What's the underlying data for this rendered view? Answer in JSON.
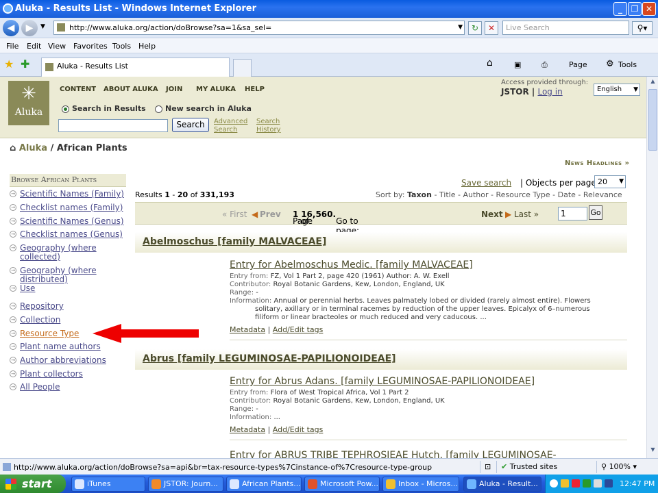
{
  "browser": {
    "title": "Aluka - Results List - Windows Internet Explorer",
    "address": "http://www.aluka.org/action/doBrowse?sa=1&sa_sel=",
    "search_placeholder": "Live Search",
    "menu": [
      "File",
      "Edit",
      "View",
      "Favorites",
      "Tools",
      "Help"
    ],
    "tab_title": "Aluka - Results List",
    "toolbar": {
      "page": "Page",
      "tools": "Tools"
    }
  },
  "site": {
    "logo_text": "Aluka",
    "nav": [
      "CONTENT",
      "ABOUT ALUKA",
      "JOIN",
      "MY ALUKA",
      "HELP"
    ],
    "access_label": "Access provided through:",
    "access_org": "JSTOR",
    "login": "Log in",
    "language": "English",
    "search_in_results": "Search in Results",
    "new_search": "New search in Aluka",
    "search_button": "Search",
    "advanced_search_1": "Advanced",
    "advanced_search_2": "Search",
    "search_history_1": "Search",
    "search_history_2": "History"
  },
  "breadcrumb": {
    "home": "Aluka",
    "sep": "/",
    "current": "African Plants"
  },
  "news_headlines": "News Headlines",
  "sidebar": {
    "heading": "Browse African Plants",
    "items": [
      {
        "label": "Scientific Names (Family)"
      },
      {
        "label": "Checklist names (Family)"
      },
      {
        "label": "Scientific Names (Genus)"
      },
      {
        "label": "Checklist names (Genus)"
      },
      {
        "label": "Geography (where",
        "label2": "collected)"
      },
      {
        "label": "Geography (where",
        "label2": "distributed)"
      },
      {
        "label": "Use"
      },
      {
        "label": "Repository"
      },
      {
        "label": "Collection"
      },
      {
        "label": "Resource Type"
      },
      {
        "label": "Plant name authors"
      },
      {
        "label": "Author abbreviations"
      },
      {
        "label": "Plant collectors"
      },
      {
        "label": "All People"
      }
    ]
  },
  "results": {
    "results_prefix": "Results",
    "range_start": "1",
    "range_sep": "-",
    "range_end": "20",
    "of": "of",
    "total": "331,193",
    "save_search": "Save search",
    "objects_per_page_label": "Objects per page:",
    "per_page": "20",
    "sort_by_label": "Sort by:",
    "sort_current": "Taxon",
    "sort_options": "- Title - Author - Resource Type - Date - Relevance",
    "pager": {
      "first": "« First",
      "prev": "Prev",
      "page_label": "Page",
      "page": "1",
      "of": "of",
      "page_total": "16,560.",
      "goto": "Go to page:",
      "goto_value": "1",
      "go": "Go",
      "next": "Next",
      "last": "Last »"
    },
    "groups": [
      {
        "title": "Abelmoschus [family MALVACEAE]",
        "entry": {
          "title": "Entry for Abelmoschus Medic. [family MALVACEAE]",
          "entry_from_label": "Entry from:",
          "entry_from": "FZ, Vol 1 Part 2, page 420 (1961) Author: A. W. Exell",
          "contributor_label": "Contributor:",
          "contributor": "Royal Botanic Gardens, Kew, London, England, UK",
          "range_label": "Range:",
          "range": "-",
          "information_label": "Information:",
          "information_1": "Annual or perennial herbs. Leaves palmately lobed or divided (rarely almost entire). Flowers",
          "information_2": "solitary, axillary or in terminal racemes by reduction of the upper leaves. Epicalyx of 6–numerous",
          "information_3": "filiform or linear bracteoles or much reduced and very caducous. ...",
          "metadata": "Metadata",
          "add_tags": "Add/Edit tags"
        }
      },
      {
        "title": "Abrus [family LEGUMINOSAE-PAPILIONOIDEAE]",
        "entry": {
          "title": "Entry for Abrus Adans. [family LEGUMINOSAE-PAPILIONOIDEAE]",
          "entry_from_label": "Entry from:",
          "entry_from": "Flora of West Tropical Africa, Vol 1 Part 2",
          "contributor_label": "Contributor:",
          "contributor": "Royal Botanic Gardens, Kew, London, England, UK",
          "range_label": "Range:",
          "range": "-",
          "information_label": "Information:",
          "information_1": "...",
          "metadata": "Metadata",
          "add_tags": "Add/Edit tags"
        }
      }
    ],
    "next_entry_title": "Entry for ABRUS TRIBE TEPHROSIEAE Hutch. [family LEGUMINOSAE-"
  },
  "statusbar": {
    "url": "http://www.aluka.org/action/doBrowse?sa=api&br=tax-resource-types%7Cinstance-of%7Cresource-type-group",
    "zone": "Trusted sites",
    "zoom": "100%"
  },
  "taskbar": {
    "start": "start",
    "tasks": [
      "iTunes",
      "JSTOR: Journ...",
      "African Plants...",
      "Microsoft Pow...",
      "Inbox - Micros...",
      "Aluka - Result..."
    ],
    "clock": "12:47 PM"
  }
}
